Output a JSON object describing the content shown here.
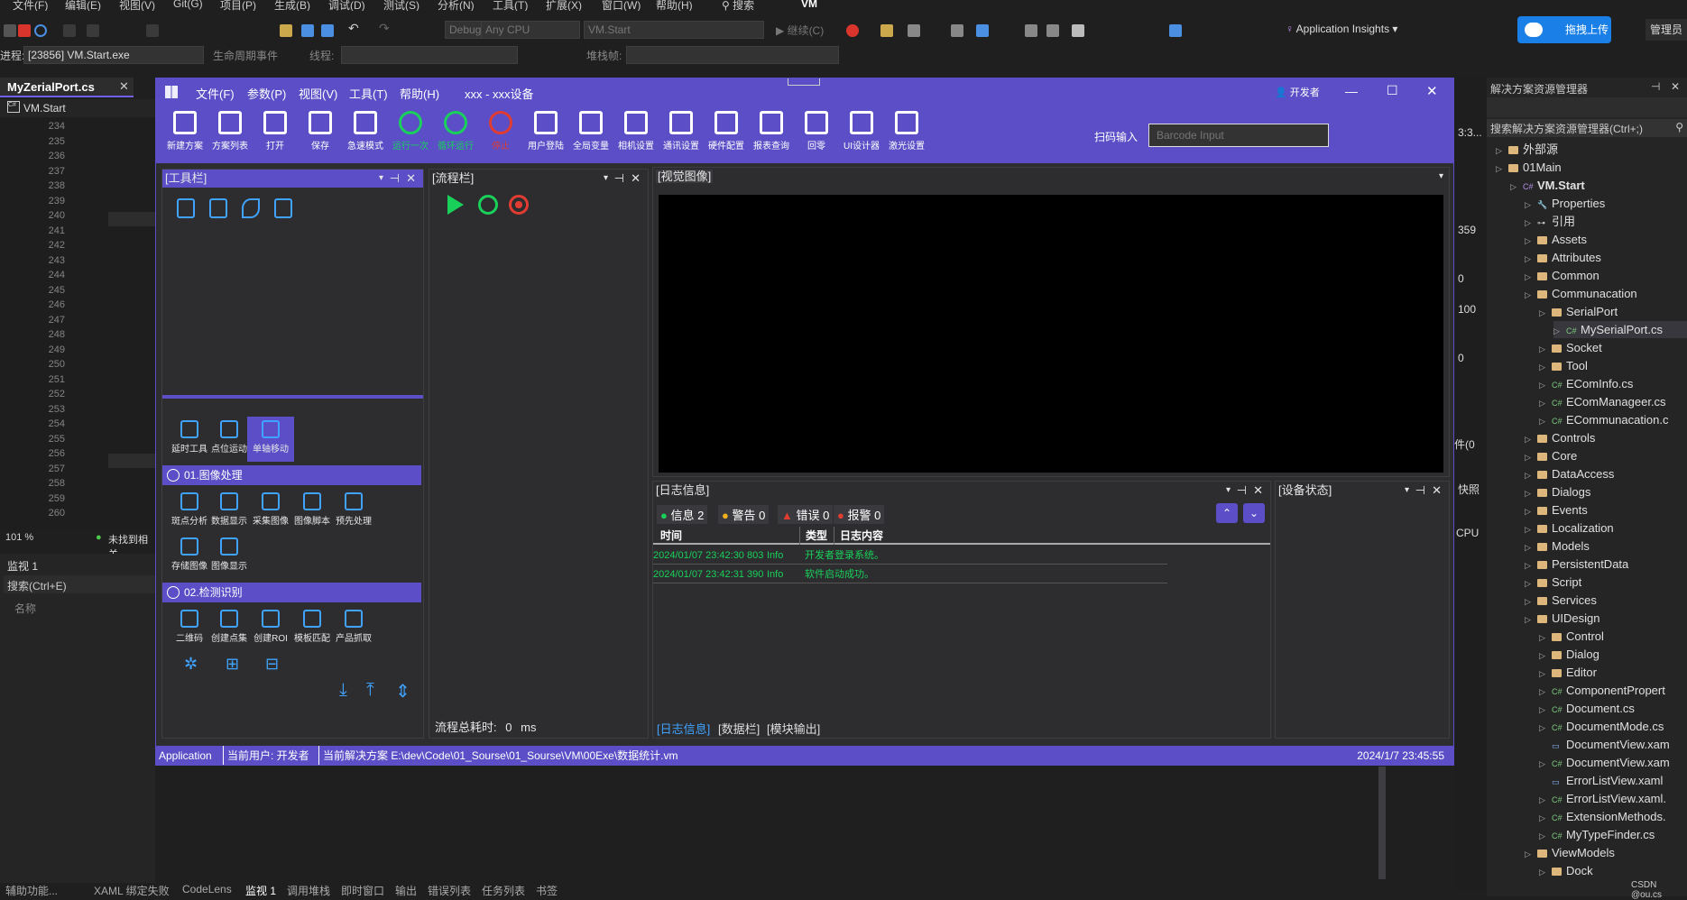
{
  "vs": {
    "menu": [
      "文件(F)",
      "编辑(E)",
      "视图(V)",
      "Git(G)",
      "项目(P)",
      "生成(B)",
      "调试(D)",
      "测试(S)",
      "分析(N)",
      "工具(T)",
      "扩展(X)",
      "窗口(W)",
      "帮助(H)"
    ],
    "search_label": "搜索",
    "solution_name": "VM",
    "config": "Debug",
    "platform": "Any CPU",
    "startup": "VM.Start",
    "continue_label": "继续(C)",
    "app_insights": "Application Insights",
    "upload_label": "拖拽上传",
    "manage_label": "管理员",
    "process_label": "进程:",
    "process_value": "[23856] VM.Start.exe",
    "lifecycle_label": "生命周期事件",
    "thread_label": "线程:",
    "stack_label": "堆栈帧:",
    "doc_tab": "MyZerialPort.cs",
    "doc_scope": "VM.Start",
    "line_numbers": [
      "234",
      "235",
      "236",
      "237",
      "238",
      "239",
      "240",
      "241",
      "242",
      "243",
      "244",
      "245",
      "246",
      "247",
      "248",
      "249",
      "250",
      "251",
      "252",
      "253",
      "254",
      "255",
      "256",
      "257",
      "258",
      "259",
      "260"
    ],
    "zoom": "101 %",
    "issues": "未找到相关",
    "watch_title": "监视 1",
    "watch_search": "搜索(Ctrl+E)",
    "watch_col": "名称",
    "bottom_tabs": [
      "辅助功能...",
      "XAML 绑定失败",
      "CodeLens",
      "监视 1",
      "调用堆栈",
      "即时窗口",
      "输出",
      "错误列表",
      "任务列表",
      "书签"
    ],
    "side_values": [
      "3:3...",
      "359",
      "0",
      "100",
      "0",
      "件(0",
      "快照",
      "CPU"
    ]
  },
  "se": {
    "title": "解决方案资源管理器",
    "search": "搜索解决方案资源管理器(Ctrl+;)",
    "items": [
      {
        "label": "外部源",
        "indent": 0,
        "kind": "ext"
      },
      {
        "label": "01Main",
        "indent": 0,
        "kind": "folder"
      },
      {
        "label": "VM.Start",
        "indent": 1,
        "kind": "proj"
      },
      {
        "label": "Properties",
        "indent": 2,
        "kind": "wrench"
      },
      {
        "label": "引用",
        "indent": 2,
        "kind": "ref"
      },
      {
        "label": "Assets",
        "indent": 2,
        "kind": "folder"
      },
      {
        "label": "Attributes",
        "indent": 2,
        "kind": "folder"
      },
      {
        "label": "Common",
        "indent": 2,
        "kind": "folder"
      },
      {
        "label": "Communacation",
        "indent": 2,
        "kind": "folder"
      },
      {
        "label": "SerialPort",
        "indent": 3,
        "kind": "folder"
      },
      {
        "label": "MySerialPort.cs",
        "indent": 4,
        "kind": "cs"
      },
      {
        "label": "Socket",
        "indent": 3,
        "kind": "folder"
      },
      {
        "label": "Tool",
        "indent": 3,
        "kind": "folder"
      },
      {
        "label": "EComInfo.cs",
        "indent": 3,
        "kind": "cs"
      },
      {
        "label": "EComManageer.cs",
        "indent": 3,
        "kind": "cs"
      },
      {
        "label": "ECommunacation.c",
        "indent": 3,
        "kind": "cs"
      },
      {
        "label": "Controls",
        "indent": 2,
        "kind": "folder"
      },
      {
        "label": "Core",
        "indent": 2,
        "kind": "folder"
      },
      {
        "label": "DataAccess",
        "indent": 2,
        "kind": "folder"
      },
      {
        "label": "Dialogs",
        "indent": 2,
        "kind": "folder"
      },
      {
        "label": "Events",
        "indent": 2,
        "kind": "folder"
      },
      {
        "label": "Localization",
        "indent": 2,
        "kind": "folder"
      },
      {
        "label": "Models",
        "indent": 2,
        "kind": "folder"
      },
      {
        "label": "PersistentData",
        "indent": 2,
        "kind": "folder"
      },
      {
        "label": "Script",
        "indent": 2,
        "kind": "folder"
      },
      {
        "label": "Services",
        "indent": 2,
        "kind": "folder"
      },
      {
        "label": "UIDesign",
        "indent": 2,
        "kind": "folder"
      },
      {
        "label": "Control",
        "indent": 3,
        "kind": "folder"
      },
      {
        "label": "Dialog",
        "indent": 3,
        "kind": "folder"
      },
      {
        "label": "Editor",
        "indent": 3,
        "kind": "folder"
      },
      {
        "label": "ComponentPropert",
        "indent": 3,
        "kind": "cs"
      },
      {
        "label": "Document.cs",
        "indent": 3,
        "kind": "cs"
      },
      {
        "label": "DocumentMode.cs",
        "indent": 3,
        "kind": "cs"
      },
      {
        "label": "DocumentView.xam",
        "indent": 3,
        "kind": "xaml"
      },
      {
        "label": "DocumentView.xam",
        "indent": 3,
        "kind": "cs"
      },
      {
        "label": "ErrorListView.xaml",
        "indent": 3,
        "kind": "xaml"
      },
      {
        "label": "ErrorListView.xaml.",
        "indent": 3,
        "kind": "cs"
      },
      {
        "label": "ExtensionMethods.",
        "indent": 3,
        "kind": "cs"
      },
      {
        "label": "MyTypeFinder.cs",
        "indent": 3,
        "kind": "cs"
      },
      {
        "label": "ViewModels",
        "indent": 2,
        "kind": "folder"
      },
      {
        "label": "Dock",
        "indent": 3,
        "kind": "folder"
      }
    ],
    "watermark": "CSDN @ou.cs"
  },
  "app": {
    "menu": [
      "文件(F)",
      "参数(P)",
      "视图(V)",
      "工具(T)",
      "帮助(H)"
    ],
    "title": "xxx - xxx设备",
    "user": "开发者",
    "ribbon": [
      "新建方案",
      "方案列表",
      "打开",
      "保存",
      "急速模式",
      "运行一次",
      "循环运行",
      "停止",
      "用户登陆",
      "全局变量",
      "相机设置",
      "通讯设置",
      "硬件配置",
      "报表查询",
      "回零",
      "UI设计器",
      "激光设置"
    ],
    "scan_label": "扫码输入",
    "barcode_placeholder": "Barcode Input",
    "toolbox_title": "[工具栏]",
    "flow_title": "[流程栏]",
    "vision_title": "[视觉图像]",
    "log_title": "[日志信息]",
    "device_title": "[设备状态]",
    "sections": {
      "motion_tools": [
        "延时工具",
        "点位运动",
        "单轴移动"
      ],
      "image_header": "01.图像处理",
      "image_tools": [
        "斑点分析",
        "数据显示",
        "采集图像",
        "图像脚本",
        "预先处理",
        "存储图像",
        "图像显示"
      ],
      "detect_header": "02.检测识别",
      "detect_tools": [
        "二维码",
        "创建点集",
        "创建ROI",
        "模板匹配",
        "产品抓取"
      ]
    },
    "flow_time_label": "流程总耗时:",
    "flow_time_value": "0",
    "flow_time_unit": "ms",
    "log_counts": {
      "info": "信息 2",
      "warn": "警告 0",
      "error": "错误 0",
      "alarm": "报警 0"
    },
    "log_columns": [
      "时间",
      "类型",
      "日志内容"
    ],
    "log_rows": [
      {
        "time": "2024/01/07 23:42:30 803",
        "type": "Info",
        "msg": "开发者登录系统。"
      },
      {
        "time": "2024/01/07 23:42:31 390",
        "type": "Info",
        "msg": "软件启动成功。"
      }
    ],
    "bottom_tabs": [
      "[日志信息]",
      "[数据栏]",
      "[模块输出]"
    ],
    "status": {
      "app": "Application",
      "user": "当前用户: 开发者",
      "solution": "当前解决方案 E:\\dev\\Code\\01_Sourse\\01_Sourse\\VM\\00Exe\\数据统计.vm",
      "time": "2024/1/7 23:45:55"
    }
  }
}
